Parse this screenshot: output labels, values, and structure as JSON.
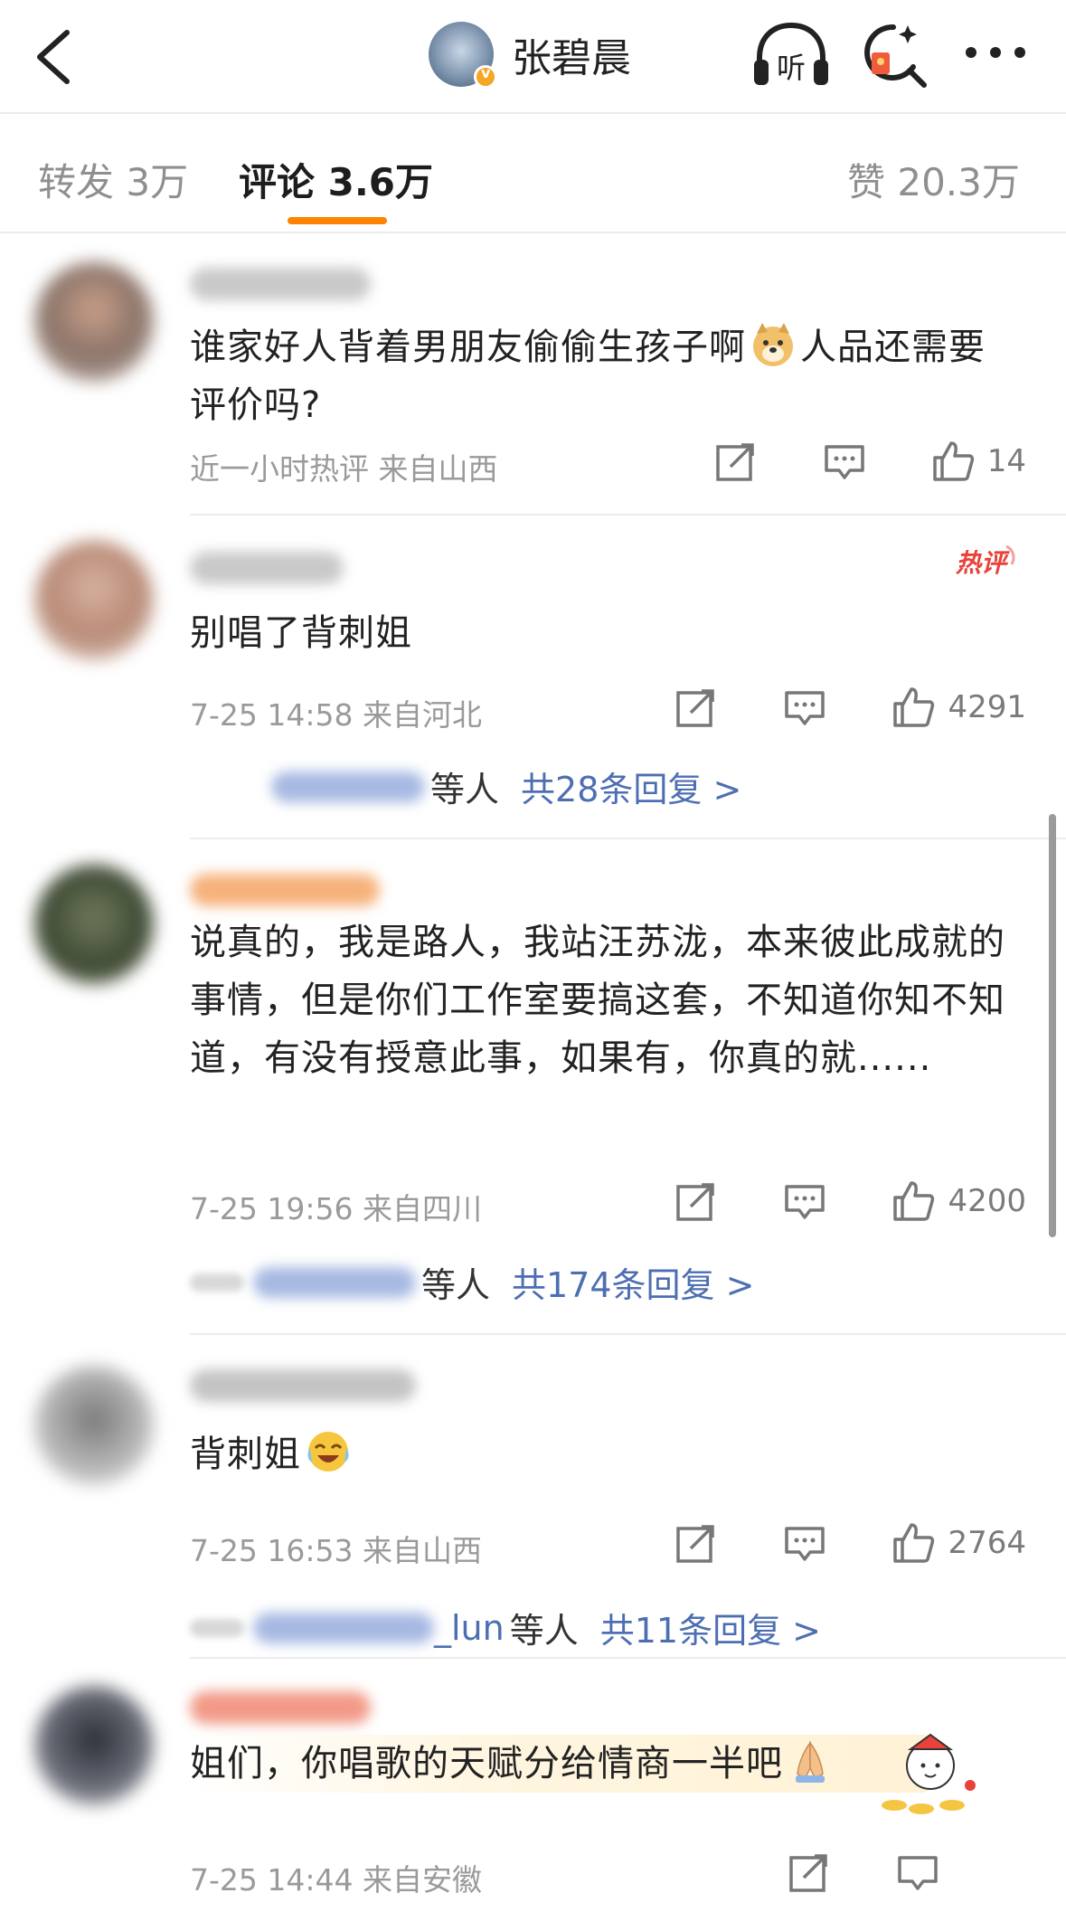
{
  "header": {
    "title": "张碧晨",
    "listen_icon": "headphones-listen-icon",
    "listen_label": "听",
    "search_icon": "search-redpacket-icon",
    "more_icon": "more-dots-icon"
  },
  "tabs": {
    "repost": "转发 3万",
    "comments": "评论 3.6万",
    "likes": "赞 20.3万"
  },
  "colors": {
    "accent": "#ff8200",
    "link": "#4d6fb2",
    "hot": "#e8423a"
  },
  "comments": [
    {
      "text_part1": "谁家好人背着男朋友偷偷生孩子啊",
      "emoji": "doge-emoji",
      "text_part2": "人品还需要评价吗?",
      "meta": "近一小时热评 来自山西",
      "likes": "14"
    },
    {
      "badge": "热评",
      "text": "别唱了背刺姐",
      "meta": "7-25 14:58 来自河北",
      "likes": "4291",
      "reply_others": "等人",
      "reply_count": "共28条回复 >"
    },
    {
      "text": "说真的，我是路人，我站汪苏泷，本来彼此成就的事情，但是你们工作室要搞这套，不知道你知不知道，有没有授意此事，如果有，你真的就......",
      "meta": "7-25 19:56 来自四川",
      "likes": "4200",
      "reply_others": "等人",
      "reply_count": "共174条回复 >"
    },
    {
      "text": "背刺姐",
      "emoji": "laugh-cry-emoji",
      "meta": "7-25 16:53 来自山西",
      "likes": "2764",
      "reply_name_tail": "_lun",
      "reply_others": "等人",
      "reply_count": "共11条回复 >"
    },
    {
      "text": "姐们，你唱歌的天赋分给情商一半吧",
      "emoji": "pray-emoji",
      "meta": "7-25 14:44 来自安徽"
    }
  ]
}
